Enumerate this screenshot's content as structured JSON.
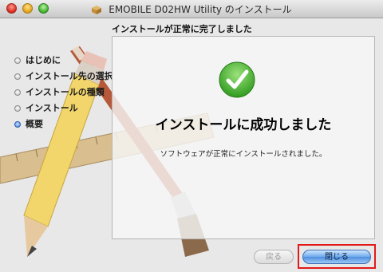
{
  "window": {
    "title": "EMOBILE D02HW Utility のインストール",
    "subtitle": "インストールが正常に完了しました"
  },
  "sidebar": {
    "steps": [
      {
        "label": "はじめに",
        "active": false
      },
      {
        "label": "インストール先の選択",
        "active": false
      },
      {
        "label": "インストールの種類",
        "active": false
      },
      {
        "label": "インストール",
        "active": false
      },
      {
        "label": "概要",
        "active": true
      }
    ]
  },
  "main": {
    "success_heading": "インストールに成功しました",
    "success_detail": "ソフトウェアが正常にインストールされました。",
    "icon": "checkmark-icon"
  },
  "footer": {
    "back_label": "戻る",
    "close_label": "閉じる"
  },
  "colors": {
    "accent": "#3b8fe6",
    "check_green": "#3aa824",
    "highlight": "#e21a1a"
  }
}
